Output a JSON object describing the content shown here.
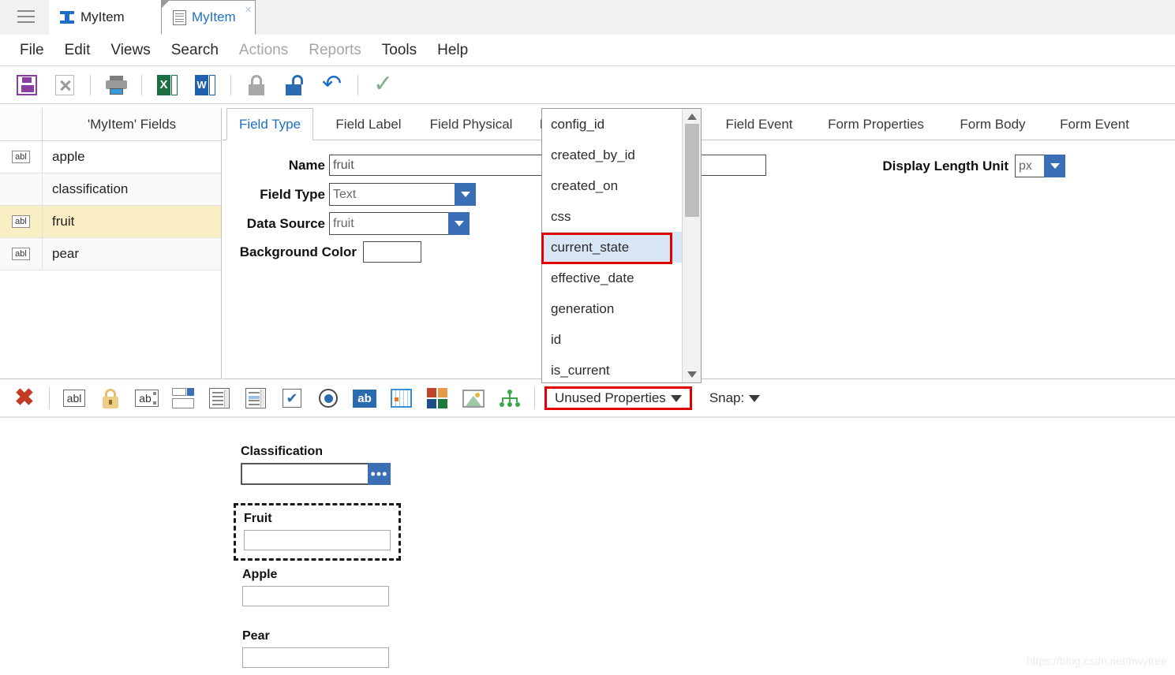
{
  "window": {
    "tabs": [
      {
        "label": "MyItem",
        "icon": "ibeam-icon",
        "active": false
      },
      {
        "label": "MyItem",
        "icon": "document-icon",
        "active": true
      }
    ],
    "menu_icon": "hamburger-icon",
    "close_glyph": "×"
  },
  "menubar": {
    "items": [
      {
        "label": "File",
        "disabled": false
      },
      {
        "label": "Edit",
        "disabled": false
      },
      {
        "label": "Views",
        "disabled": false
      },
      {
        "label": "Search",
        "disabled": false
      },
      {
        "label": "Actions",
        "disabled": true
      },
      {
        "label": "Reports",
        "disabled": true
      },
      {
        "label": "Tools",
        "disabled": false
      },
      {
        "label": "Help",
        "disabled": false
      }
    ]
  },
  "toolbar": {
    "buttons": [
      {
        "name": "save-icon"
      },
      {
        "name": "close-document-icon"
      },
      {
        "name": "print-icon"
      },
      {
        "name": "export-excel-icon"
      },
      {
        "name": "export-word-icon"
      },
      {
        "name": "lock-icon"
      },
      {
        "name": "unlock-icon"
      },
      {
        "name": "undo-icon",
        "glyph": "↶"
      },
      {
        "name": "apply-check-icon",
        "glyph": "✓"
      }
    ]
  },
  "fields_panel": {
    "header": "'MyItem' Fields",
    "rows": [
      {
        "type_icon": "abl",
        "name": "apple",
        "selected": false
      },
      {
        "type_icon": "",
        "name": "classification",
        "selected": false
      },
      {
        "type_icon": "abl",
        "name": "fruit",
        "selected": true
      },
      {
        "type_icon": "abl",
        "name": "pear",
        "selected": false
      }
    ]
  },
  "property_tabs": [
    {
      "label": "Field Type",
      "active": true
    },
    {
      "label": "Field Label",
      "active": false
    },
    {
      "label": "Field Physical",
      "active": false
    },
    {
      "label": "F",
      "active": false
    },
    {
      "label": "Field Event",
      "active": false
    },
    {
      "label": "Form Properties",
      "active": false
    },
    {
      "label": "Form Body",
      "active": false
    },
    {
      "label": "Form Event",
      "active": false
    }
  ],
  "field_type_form": {
    "name_label": "Name",
    "name_value": "fruit",
    "field_type_label": "Field Type",
    "field_type_value": "Text",
    "data_source_label": "Data Source",
    "data_source_value": "fruit",
    "background_color_label": "Background Color",
    "background_color_value": "",
    "display_length_unit_label": "Display Length Unit",
    "display_length_unit_value": "px",
    "extra_input_value": ""
  },
  "dropdown": {
    "items": [
      {
        "label": "config_id",
        "selected": false
      },
      {
        "label": "created_by_id",
        "selected": false
      },
      {
        "label": "created_on",
        "selected": false
      },
      {
        "label": "css",
        "selected": false
      },
      {
        "label": "current_state",
        "selected": true
      },
      {
        "label": "effective_date",
        "selected": false
      },
      {
        "label": "generation",
        "selected": false
      },
      {
        "label": "id",
        "selected": false
      },
      {
        "label": "is_current",
        "selected": false
      }
    ],
    "scroll_up_icon": "scroll-up-arrow-icon",
    "scroll_down_icon": "scroll-down-arrow-icon",
    "highlight_color": "#e00000"
  },
  "widget_toolbar": {
    "buttons": [
      {
        "name": "delete-widget-icon",
        "glyph": "✖"
      },
      {
        "name": "text-field-icon"
      },
      {
        "name": "password-field-icon"
      },
      {
        "name": "text-area-icon"
      },
      {
        "name": "combo-box-icon"
      },
      {
        "name": "list-box-icon"
      },
      {
        "name": "selected-list-icon"
      },
      {
        "name": "checkbox-icon",
        "glyph": "✔"
      },
      {
        "name": "radio-button-icon"
      },
      {
        "name": "button-icon",
        "glyph": "ab"
      },
      {
        "name": "grid-icon"
      },
      {
        "name": "tiles-icon"
      },
      {
        "name": "image-icon"
      },
      {
        "name": "tree-icon"
      }
    ],
    "unused_properties_label": "Unused Properties",
    "snap_label": "Snap:"
  },
  "preview": {
    "groups": [
      {
        "label": "Classification",
        "control": "combo-picker",
        "value": "",
        "selected": false,
        "button_glyph": "•••"
      },
      {
        "label": "Fruit",
        "control": "text",
        "value": "",
        "selected": true
      },
      {
        "label": "Apple",
        "control": "text",
        "value": "",
        "selected": false
      },
      {
        "label": "Pear",
        "control": "text",
        "value": "",
        "selected": false
      }
    ]
  },
  "watermark": "https://blog.csdn.net/hwytree"
}
